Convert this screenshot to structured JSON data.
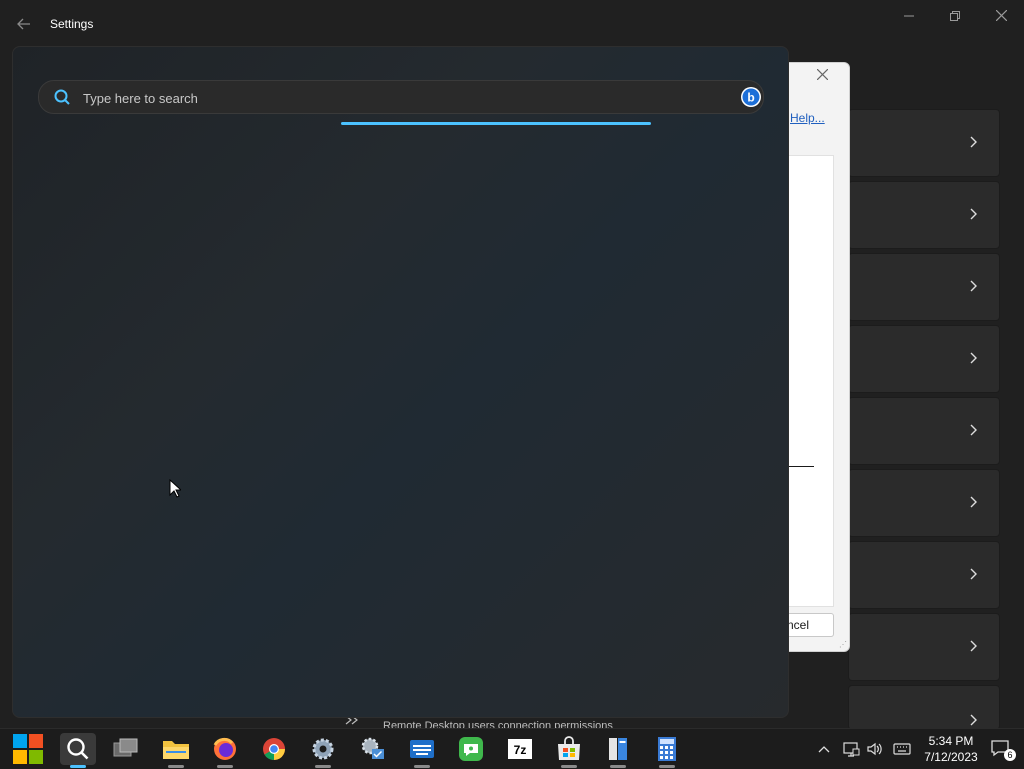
{
  "window": {
    "title": "Settings",
    "back_icon": "arrow-left-icon",
    "controls": [
      "minimize-icon",
      "maximize-icon",
      "close-icon"
    ]
  },
  "dialog": {
    "help_link": "Help...",
    "cancel_label": "ncel"
  },
  "background_row": {
    "text": "Remote Desktop users connection permissions",
    "icon": "remote-desktop-icon"
  },
  "search": {
    "placeholder": "Type here to search",
    "value": "",
    "progress_percent": 100,
    "accent": "#4cc2ff"
  },
  "taskbar": {
    "apps": [
      "start-icon",
      "search-icon",
      "task-view-icon",
      "file-explorer-icon",
      "firefox-icon",
      "chrome-icon",
      "settings-app-icon",
      "control-panel-icon",
      "keyboard-app-icon",
      "messaging-app-icon",
      "7zip-icon",
      "store-icon",
      "book-app-icon",
      "calculator-icon"
    ],
    "seven_zip_label": "7z",
    "clock_time": "5:34 PM",
    "clock_date": "7/12/2023",
    "notification_count": "6"
  },
  "colors": {
    "background": "#202020",
    "panel": "#242a2f",
    "accent": "#4cc2ff",
    "taskbar": "#1c1c1c"
  }
}
